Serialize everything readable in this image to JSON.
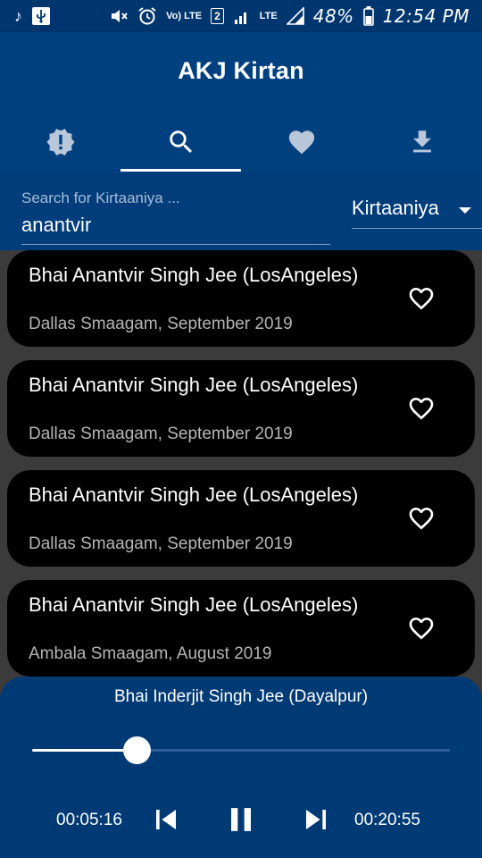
{
  "status_bar": {
    "left_icons": [
      "music-note-icon",
      "usb-icon"
    ],
    "right_icons": [
      "mute-icon",
      "alarm-icon",
      "volte-icon",
      "sim2-icon",
      "signal-icon",
      "lte-icon",
      "signal-2-icon",
      "battery-icon"
    ],
    "volte_text": "Vo) LTE",
    "sim_badge": "2",
    "lte_text": "LTE",
    "battery": "48%",
    "time": "12:54 PM"
  },
  "app": {
    "title": "AKJ Kirtan"
  },
  "tabs": [
    {
      "icon": "alert-icon",
      "selected": false
    },
    {
      "icon": "search-icon",
      "selected": true
    },
    {
      "icon": "heart-icon",
      "selected": false
    },
    {
      "icon": "download-icon",
      "selected": false
    }
  ],
  "search": {
    "placeholder": "Search for Kirtaaniya ...",
    "value": "anantvir",
    "filter": "Kirtaaniya"
  },
  "results": [
    {
      "title": "Bhai Anantvir Singh Jee (LosAngeles)",
      "subtitle": "Dallas Smaagam, September 2019"
    },
    {
      "title": "Bhai Anantvir Singh Jee (LosAngeles)",
      "subtitle": "Dallas Smaagam, September 2019"
    },
    {
      "title": "Bhai Anantvir Singh Jee (LosAngeles)",
      "subtitle": "Dallas Smaagam, September 2019"
    },
    {
      "title": "Bhai Anantvir Singh Jee (LosAngeles)",
      "subtitle": "Ambala Smaagam, August 2019"
    }
  ],
  "player": {
    "now_playing": "Bhai Inderjit Singh Jee (Dayalpur)",
    "elapsed": "00:05:16",
    "total": "00:20:55",
    "progress": 0.25
  },
  "colors": {
    "header": "#00407f",
    "player": "#003a75",
    "card": "#000000",
    "background": "#3b3b3b"
  }
}
